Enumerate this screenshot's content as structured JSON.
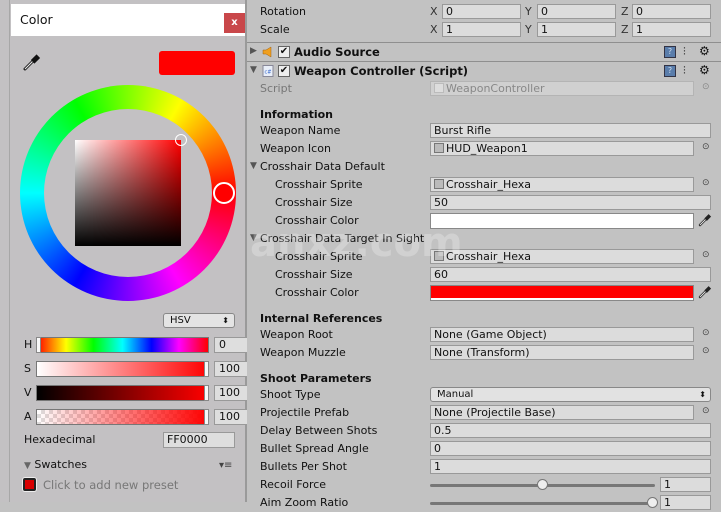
{
  "color_window": {
    "title": "Color",
    "close_label": "x",
    "preview_color": "#FF0000",
    "mode": "HSV",
    "sliders": [
      {
        "label": "H",
        "value": "0"
      },
      {
        "label": "S",
        "value": "100"
      },
      {
        "label": "V",
        "value": "100"
      },
      {
        "label": "A",
        "value": "100"
      }
    ],
    "hex_label": "Hexadecimal",
    "hex_value": "FF0000",
    "swatches_label": "Swatches",
    "preset_label": "Click to add new preset",
    "swatches_menu": "▾≡"
  },
  "transform": {
    "rotation_label": "Rotation",
    "rotation": {
      "x": "0",
      "y": "0",
      "z": "0"
    },
    "scale_label": "Scale",
    "scale": {
      "x": "1",
      "y": "1",
      "z": "1"
    },
    "axis_x": "X",
    "axis_y": "Y",
    "axis_z": "Z"
  },
  "components": {
    "audio_source": "Audio Source",
    "weapon_controller": "Weapon Controller (Script)"
  },
  "script": {
    "label": "Script",
    "value": "WeaponController"
  },
  "information": {
    "header": "Information",
    "weapon_name_label": "Weapon Name",
    "weapon_name": "Burst Rifle",
    "weapon_icon_label": "Weapon Icon",
    "weapon_icon": "HUD_Weapon1"
  },
  "crosshair_default": {
    "header": "Crosshair Data Default",
    "sprite_label": "Crosshair Sprite",
    "sprite": "Crosshair_Hexa",
    "size_label": "Crosshair Size",
    "size": "50",
    "color_label": "Crosshair Color",
    "color": "#FFFFFF"
  },
  "crosshair_target": {
    "header": "Crosshair Data Target In Sight",
    "sprite_label": "Crosshair Sprite",
    "sprite": "Crosshair_Hexa",
    "size_label": "Crosshair Size",
    "size": "60",
    "color_label": "Crosshair Color",
    "color": "#FF0000"
  },
  "internal_refs": {
    "header": "Internal References",
    "root_label": "Weapon Root",
    "root": "None (Game Object)",
    "muzzle_label": "Weapon Muzzle",
    "muzzle": "None (Transform)"
  },
  "shoot": {
    "header": "Shoot Parameters",
    "type_label": "Shoot Type",
    "type": "Manual",
    "projectile_label": "Projectile Prefab",
    "projectile": "None (Projectile Base)",
    "delay_label": "Delay Between Shots",
    "delay": "0.5",
    "spread_label": "Bullet Spread Angle",
    "spread": "0",
    "bullets_label": "Bullets Per Shot",
    "bullets": "1",
    "recoil_label": "Recoil Force",
    "recoil": "1",
    "aim_zoom_label": "Aim Zoom Ratio",
    "aim_zoom": "1"
  },
  "watermark": "anxz.com"
}
